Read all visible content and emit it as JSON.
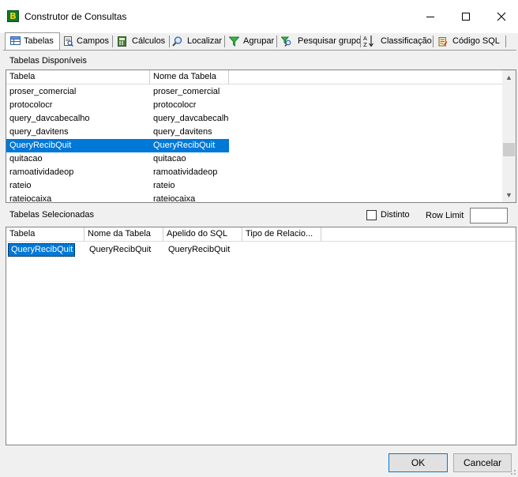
{
  "window": {
    "title": "Construtor de Consultas",
    "app_icon_letter": "B"
  },
  "tabs": [
    {
      "label": "Tabelas",
      "icon": "table-icon",
      "active": true
    },
    {
      "label": "Campos",
      "icon": "fields-icon",
      "active": false
    },
    {
      "label": "Cálculos",
      "icon": "calculator-icon",
      "active": false
    },
    {
      "label": "Localizar",
      "icon": "magnifier-icon",
      "active": false
    },
    {
      "label": "Agrupar",
      "icon": "funnel-icon",
      "active": false
    },
    {
      "label": "Pesquisar grupo",
      "icon": "search-group-icon",
      "active": false
    },
    {
      "label": "Classificação",
      "icon": "sort-az-icon",
      "active": false
    },
    {
      "label": "Código SQL",
      "icon": "sql-script-icon",
      "active": false
    }
  ],
  "available": {
    "section_label": "Tabelas Disponíveis",
    "columns": [
      "Tabela",
      "Nome da Tabela"
    ],
    "rows": [
      {
        "tabela": "proser_comercial",
        "nome": "proser_comercial",
        "selected": false
      },
      {
        "tabela": "protocolocr",
        "nome": "protocolocr",
        "selected": false
      },
      {
        "tabela": "query_davcabecalho",
        "nome": "query_davcabecalho",
        "selected": false
      },
      {
        "tabela": "query_davitens",
        "nome": "query_davitens",
        "selected": false
      },
      {
        "tabela": "QueryRecibQuit",
        "nome": "QueryRecibQuit",
        "selected": true
      },
      {
        "tabela": "quitacao",
        "nome": "quitacao",
        "selected": false
      },
      {
        "tabela": "ramoatividadeop",
        "nome": "ramoatividadeop",
        "selected": false
      },
      {
        "tabela": "rateio",
        "nome": "rateio",
        "selected": false
      },
      {
        "tabela": "rateiocaixa",
        "nome": "rateiocaixa",
        "selected": false
      }
    ]
  },
  "selected_tables": {
    "section_label": "Tabelas Selecionadas",
    "distinct_label": "Distinto",
    "distinct_checked": false,
    "row_limit_label": "Row Limit",
    "row_limit_value": "",
    "columns": [
      "Tabela",
      "Nome da Tabela",
      "Apelido do SQL",
      "Tipo de Relacio..."
    ],
    "rows": [
      {
        "tabela": "QueryRecibQuit",
        "nome": "QueryRecibQuit",
        "apelido": "QueryRecibQuit",
        "tipo": "",
        "selected": true
      }
    ]
  },
  "buttons": {
    "ok": "OK",
    "cancel": "Cancelar"
  },
  "colors": {
    "selection": "#0078d7",
    "window_bg": "#f0f0f0"
  }
}
